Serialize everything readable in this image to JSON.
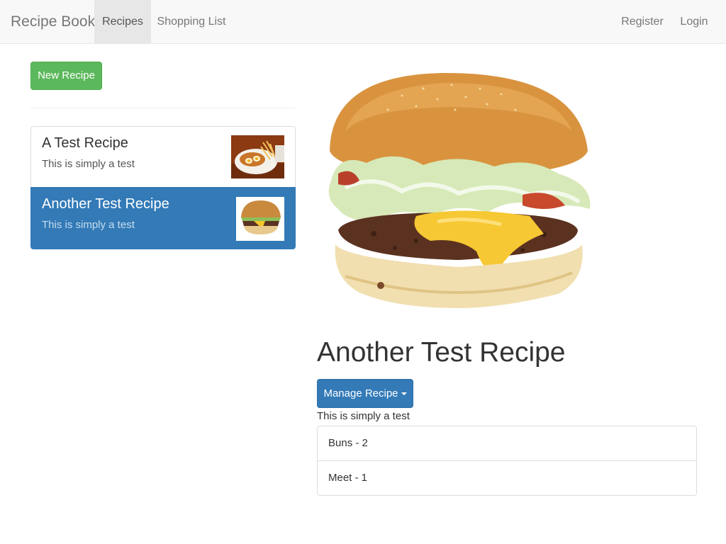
{
  "nav": {
    "brand": "Recipe Book",
    "links": [
      "Recipes",
      "Shopping List"
    ],
    "right_links": [
      "Register",
      "Login"
    ],
    "active": "Recipes"
  },
  "sidebar": {
    "new_button": "New Recipe",
    "recipes": [
      {
        "name": "A Test Recipe",
        "description": "This is simply a test",
        "thumbnail": "food-plate-image",
        "active": false
      },
      {
        "name": "Another Test Recipe",
        "description": "This is simply a test",
        "thumbnail": "burger-image",
        "active": true
      }
    ]
  },
  "detail": {
    "image": "burger-image",
    "title": "Another Test Recipe",
    "manage_button": "Manage Recipe",
    "description": "This is simply a test",
    "ingredients": [
      "Buns - 2",
      "Meet - 1"
    ]
  },
  "colors": {
    "primary": "#337ab7",
    "success": "#5cb85c",
    "navbar_bg": "#f8f8f8",
    "nav_active_bg": "#e7e7e7"
  }
}
